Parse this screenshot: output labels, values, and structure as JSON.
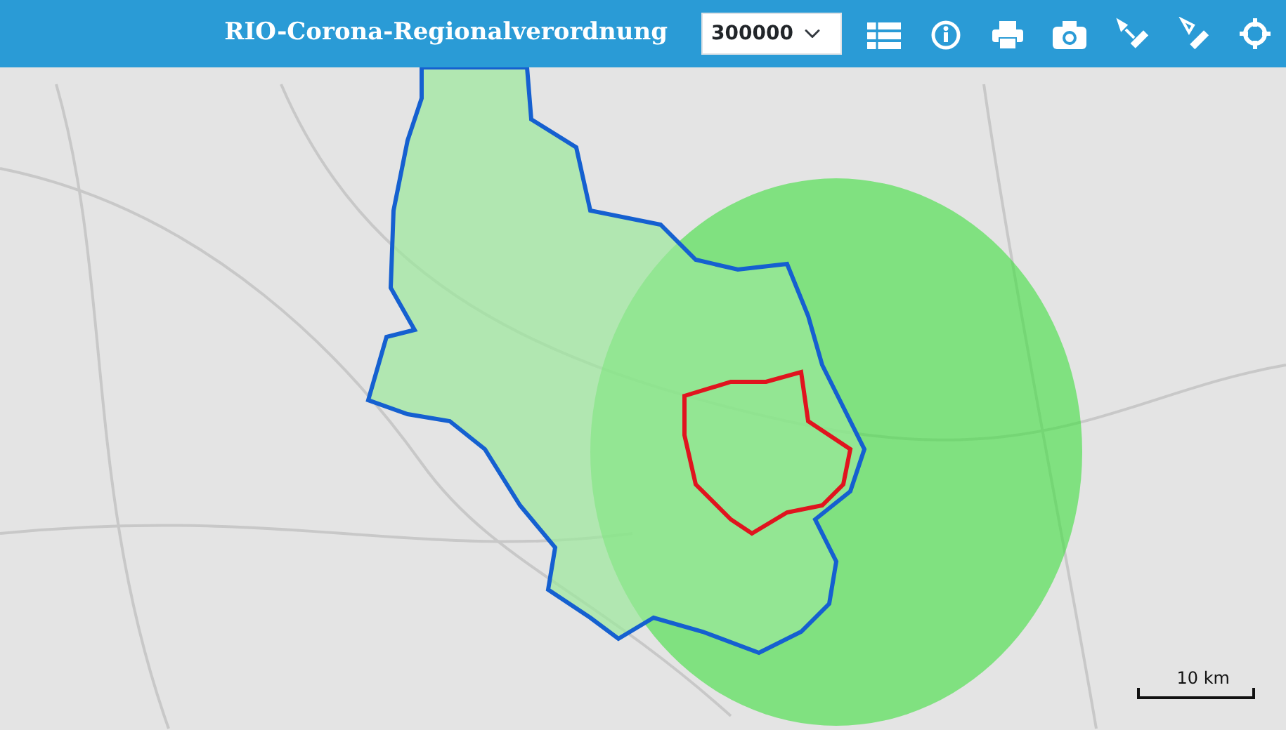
{
  "header": {
    "title": "RIO-Corona-Regionalverordnung",
    "scale_select": {
      "value": "300000"
    }
  },
  "map": {
    "scale_bar": {
      "label": "10 km"
    }
  }
}
